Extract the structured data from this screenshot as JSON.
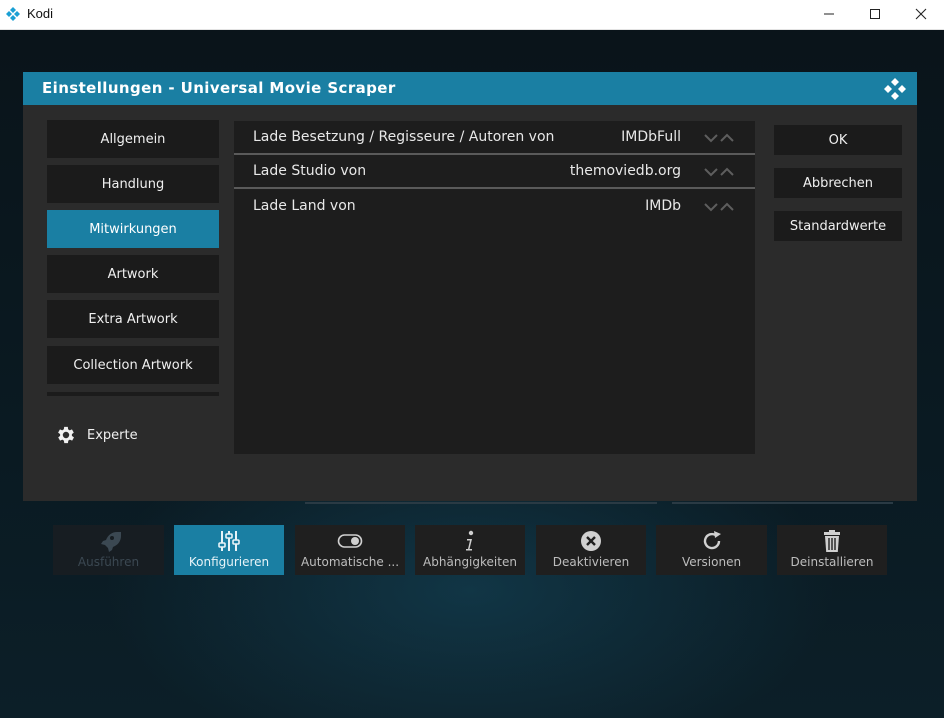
{
  "window": {
    "title": "Kodi",
    "controls": [
      "minimize",
      "maximize",
      "close"
    ]
  },
  "dialog": {
    "title": "Einstellungen - Universal Movie Scraper",
    "categories": [
      {
        "label": "Allgemein",
        "active": false
      },
      {
        "label": "Handlung",
        "active": false
      },
      {
        "label": "Mitwirkungen",
        "active": true
      },
      {
        "label": "Artwork",
        "active": false
      },
      {
        "label": "Extra Artwork",
        "active": false
      },
      {
        "label": "Collection Artwork",
        "active": false
      }
    ],
    "expert_level": {
      "label": "Experte",
      "icon": "gear-icon"
    },
    "settings": [
      {
        "label": "Lade Besetzung / Regisseure / Autoren von",
        "value": "IMDbFull"
      },
      {
        "label": "Lade Studio von",
        "value": "themoviedb.org"
      },
      {
        "label": "Lade Land von",
        "value": "IMDb"
      }
    ],
    "buttons": {
      "ok": "OK",
      "cancel": "Abbrechen",
      "defaults": "Standardwerte"
    }
  },
  "actions": [
    {
      "label": "Ausführen",
      "icon": "rocket-icon",
      "state": "disabled"
    },
    {
      "label": "Konfigurieren",
      "icon": "sliders-icon",
      "state": "active"
    },
    {
      "label": "Automatische ...",
      "icon": "toggle-icon",
      "state": "normal"
    },
    {
      "label": "Abhängigkeiten",
      "icon": "info-icon",
      "state": "normal"
    },
    {
      "label": "Deaktivieren",
      "icon": "close-circle-icon",
      "state": "normal"
    },
    {
      "label": "Versionen",
      "icon": "refresh-icon",
      "state": "normal"
    },
    {
      "label": "Deinstallieren",
      "icon": "trash-icon",
      "state": "normal"
    }
  ],
  "colors": {
    "accent": "#1a7fa3",
    "dialog_bg": "#2b2b2b",
    "panel_bg": "#1d1d1d",
    "button_bg": "#1b1b1b"
  }
}
